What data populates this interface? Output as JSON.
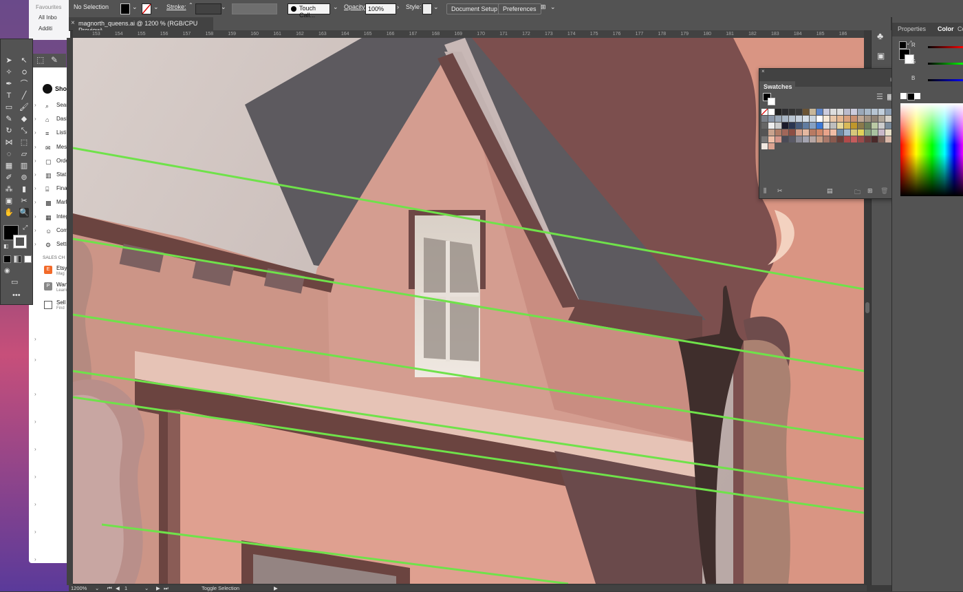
{
  "background_app": {
    "mail": {
      "favourites": "Favourites",
      "row1": "All Inbo",
      "row2": "Additi"
    },
    "shop": {
      "title": "Sho",
      "items": [
        "Sear",
        "Dash",
        "Listi",
        "Mess",
        "Orde",
        "Stat",
        "Fina",
        "Mark",
        "Integ",
        "Com",
        "Setti"
      ],
      "sales_channels": "SALES CH",
      "channels": [
        {
          "name": "Etsy",
          "sub": "Mag",
          "badge": "E"
        },
        {
          "name": "Wan",
          "sub": "Learn",
          "badge": "P"
        },
        {
          "name": "Sell",
          "sub": "Find"
        }
      ]
    }
  },
  "control_bar": {
    "selection": "No Selection",
    "stroke_label": "Stroke:",
    "brush": "Touch Call...",
    "opacity_label": "Opacity:",
    "opacity_value": "100%",
    "style_label": "Style:",
    "document_setup": "Document Setup",
    "preferences": "Preferences"
  },
  "document": {
    "tab_title": "magnorth_queens.ai @ 1200 % (RGB/CPU Preview)",
    "close": "×"
  },
  "ruler": {
    "ticks": [
      "153",
      "154",
      "155",
      "156",
      "157",
      "158",
      "159",
      "160",
      "161",
      "162",
      "163",
      "164",
      "165",
      "166",
      "167",
      "168",
      "169",
      "170",
      "171",
      "172",
      "173",
      "174",
      "175",
      "176",
      "177",
      "178",
      "179",
      "180",
      "181",
      "182",
      "183",
      "184",
      "185",
      "186"
    ]
  },
  "swatches_panel": {
    "title": "Swatches"
  },
  "properties_panel": {
    "tabs": [
      "Properties",
      "Color",
      "Co"
    ],
    "channels": [
      "R",
      "G",
      "B"
    ]
  },
  "status_bar": {
    "zoom": "1200%",
    "artboard": "1",
    "hint": "Toggle Selection"
  },
  "colors": {
    "ui_panel": "#535353",
    "ui_dark": "#424242",
    "guide_green": "#6fe24a",
    "sky": "#c9bcb8",
    "roof_grey": "#5e5b60",
    "wall_pink": "#d4a093",
    "trim_brown": "#6b4440"
  }
}
